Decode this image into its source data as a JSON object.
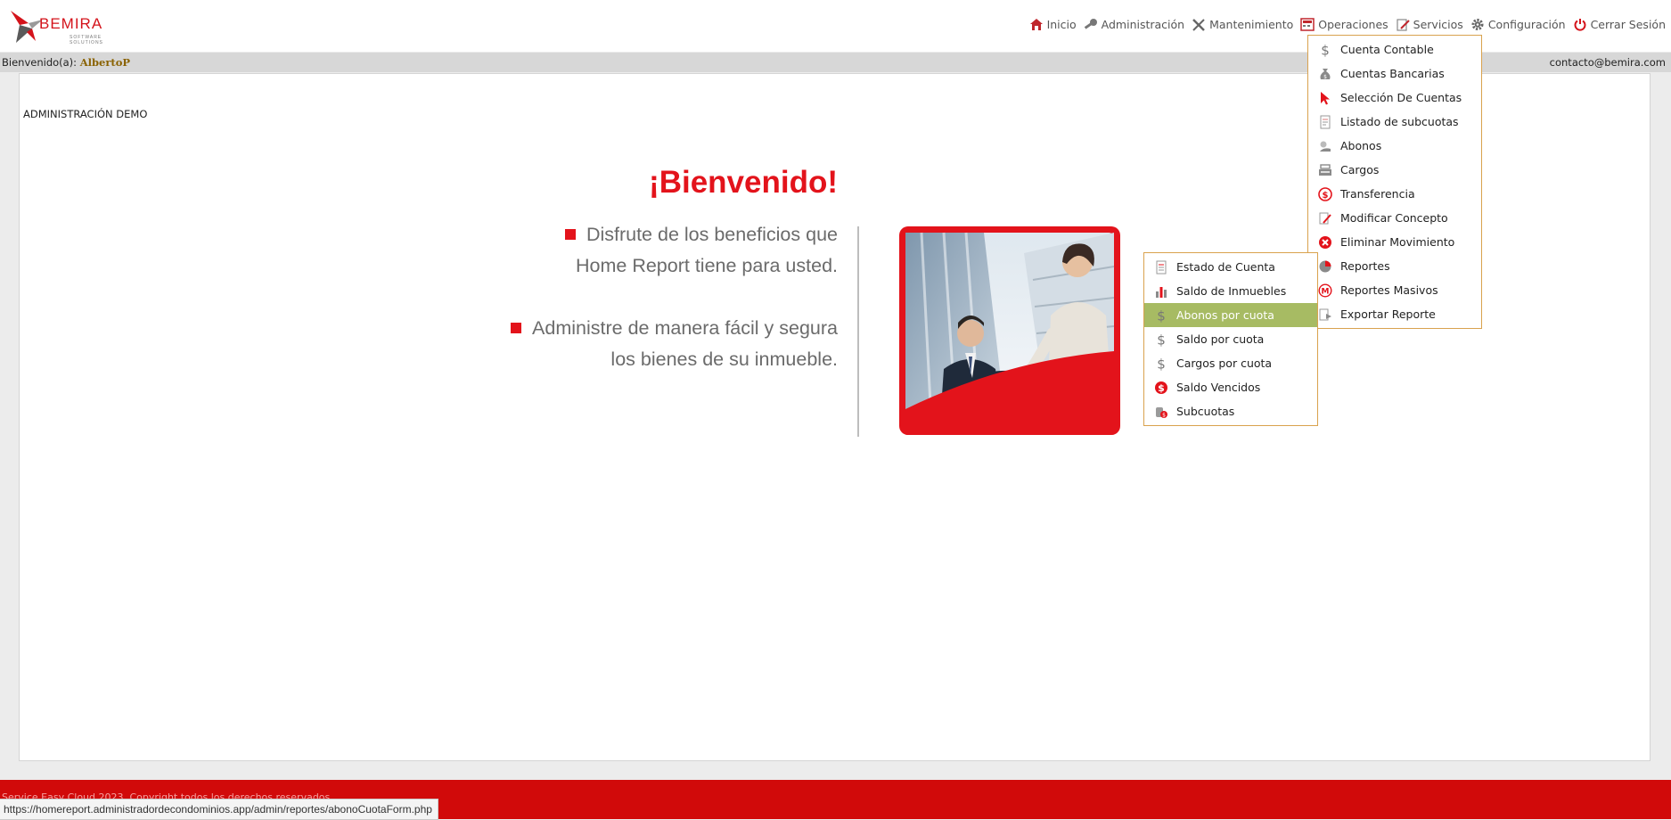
{
  "brand": {
    "name": "BEMIRA",
    "tagline": "SOFTWARE SOLUTIONS",
    "accent": "#e3131b"
  },
  "nav": [
    {
      "label": "Inicio",
      "icon": "home-icon"
    },
    {
      "label": "Administración",
      "icon": "key-icon"
    },
    {
      "label": "Mantenimiento",
      "icon": "tools-icon"
    },
    {
      "label": "Operaciones",
      "icon": "calculator-icon"
    },
    {
      "label": "Servicios",
      "icon": "edit-icon"
    },
    {
      "label": "Configuración",
      "icon": "gear-icon"
    },
    {
      "label": "Cerrar Sesión",
      "icon": "power-icon"
    }
  ],
  "statusbar": {
    "welcome": "Bienvenido(a):",
    "user": "AlbertoP",
    "contact": "contacto@bemira.com"
  },
  "content": {
    "admin_name": "ADMINISTRACIÓN DEMO",
    "title": "¡Bienvenido!",
    "bullet1": {
      "line1": "Disfrute de los beneficios que",
      "line2": "Home Report tiene para usted."
    },
    "bullet2": {
      "line1": "Administre de manera fácil y segura",
      "line2": "los bienes de su inmueble."
    }
  },
  "operaciones_menu": [
    {
      "label": "Cuenta Contable",
      "icon": "dollar-icon"
    },
    {
      "label": "Cuentas Bancarias",
      "icon": "money-bag-icon"
    },
    {
      "label": "Selección De Cuentas",
      "icon": "cursor-icon"
    },
    {
      "label": "Listado de subcuotas",
      "icon": "document-list-icon"
    },
    {
      "label": "Abonos",
      "icon": "hand-coin-icon"
    },
    {
      "label": "Cargos",
      "icon": "cash-register-icon"
    },
    {
      "label": "Transferencia",
      "icon": "transfer-icon"
    },
    {
      "label": "Modificar Concepto",
      "icon": "edit-document-icon"
    },
    {
      "label": "Eliminar Movimiento",
      "icon": "delete-icon"
    },
    {
      "label": "Reportes",
      "icon": "pie-chart-icon"
    },
    {
      "label": "Reportes Masivos",
      "icon": "m-badge-icon"
    },
    {
      "label": "Exportar Reporte",
      "icon": "export-icon"
    }
  ],
  "reportes_menu": [
    {
      "label": "Estado de Cuenta",
      "icon": "statement-icon",
      "active": false
    },
    {
      "label": "Saldo de Inmuebles",
      "icon": "bar-chart-icon",
      "active": false
    },
    {
      "label": "Abonos por cuota",
      "icon": "dollar-icon",
      "active": true
    },
    {
      "label": "Saldo por cuota",
      "icon": "dollar-icon",
      "active": false
    },
    {
      "label": "Cargos por cuota",
      "icon": "dollar-icon",
      "active": false
    },
    {
      "label": "Saldo Vencidos",
      "icon": "dollar-circle-icon",
      "active": false
    },
    {
      "label": "Subcuotas",
      "icon": "coins-icon",
      "active": false
    }
  ],
  "footer": {
    "text": "Service Easy Cloud 2023. Copyright todos los derechos reservados"
  },
  "status_url": "https://homereport.administradordecondominios.app/admin/reportes/abonoCuotaForm.php"
}
